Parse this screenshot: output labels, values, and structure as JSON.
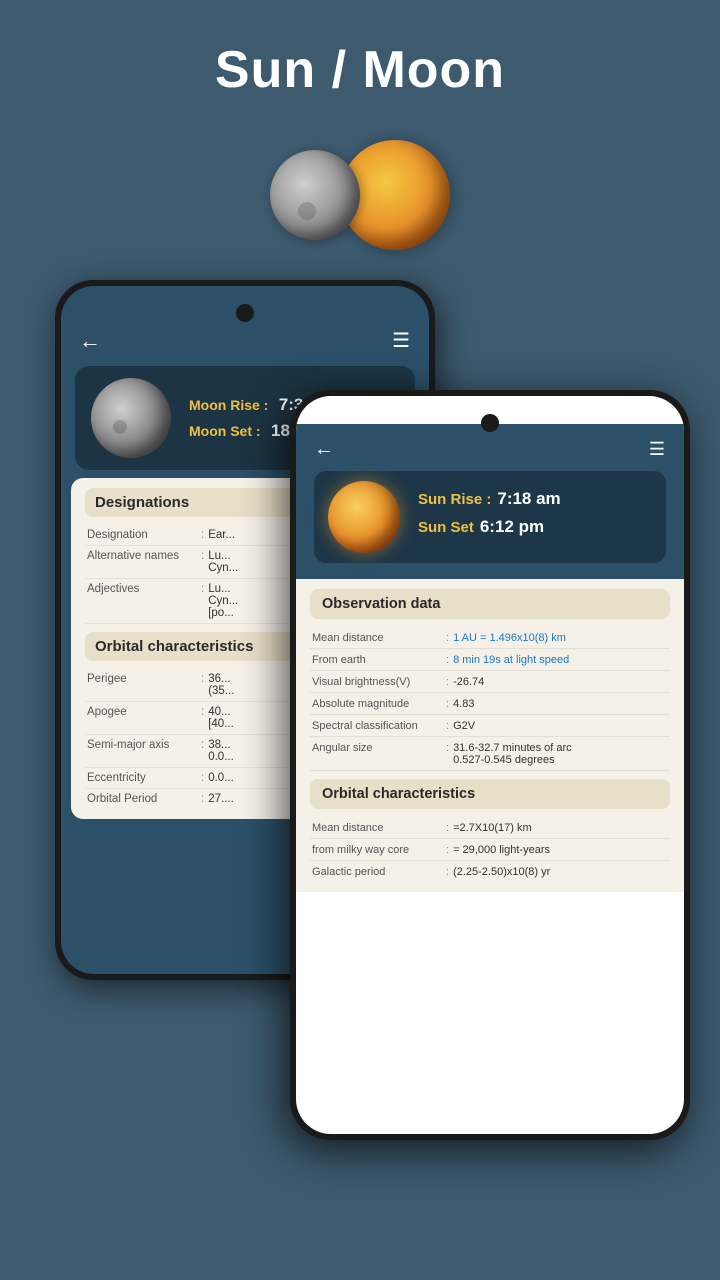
{
  "header": {
    "title": "Sun / Moon"
  },
  "phoneBack": {
    "moonRiseLabel": "Moon Rise :",
    "moonRiseValue": "7:39:48",
    "moonSetLabel": "Moon Set  :",
    "moonSetValue": "18:50:57",
    "designationsSection": "Designations",
    "rows": [
      {
        "label": "Designation",
        "colon": ":",
        "value": "Ear..."
      },
      {
        "label": "Alternative names",
        "colon": ":",
        "value": "Lu...\nCyn..."
      },
      {
        "label": "Adjectives",
        "colon": ":",
        "value": "Lu...\nCyn...\n[po..."
      }
    ],
    "orbitalSection": "Orbital characteristics",
    "orbRows": [
      {
        "label": "Perigee",
        "colon": ":",
        "value": "36...\n(35..."
      },
      {
        "label": "Apogee",
        "colon": ":",
        "value": "40...\n[40..."
      },
      {
        "label": "Semi-major axis",
        "colon": ":",
        "value": "38...\n0.0..."
      },
      {
        "label": "Eccentricity",
        "colon": ":",
        "value": "0.0..."
      },
      {
        "label": "Orbital Period",
        "colon": ":",
        "value": "27...."
      }
    ]
  },
  "phoneFront": {
    "sunRiseLabel": "Sun Rise :",
    "sunRiseValue": "7:18 am",
    "sunSetLabel": "Sun Set",
    "sunSetValue": "6:12 pm",
    "observationSection": "Observation data",
    "obsRows": [
      {
        "label": "Mean distance",
        "colon": ":",
        "value": "1 AU = 1.496x10(8) km",
        "highlight": true
      },
      {
        "label": "From earth",
        "colon": ":",
        "value": "8 min 19s at light speed",
        "highlight": true
      },
      {
        "label": "Visual brightness(V)",
        "colon": ":",
        "value": "-26.74"
      },
      {
        "label": "Absolute magnitude",
        "colon": ":",
        "value": "4.83"
      },
      {
        "label": "Spectral classification",
        "colon": ":",
        "value": "G2V"
      },
      {
        "label": "Angular size",
        "colon": ":",
        "value": "31.6-32.7 minutes of arc\n0.527-0.545 degrees"
      }
    ],
    "orbitalSection": "Orbital characteristics",
    "orbRows": [
      {
        "label": "Mean distance",
        "colon": ":",
        "value": "=2.7X10(17) km"
      },
      {
        "label": "from milky way core",
        "colon": ":",
        "value": "= 29,000 light-years"
      },
      {
        "label": "Galactic period",
        "colon": ":",
        "value": "(2.25-2.50)x10(8) yr"
      }
    ]
  }
}
